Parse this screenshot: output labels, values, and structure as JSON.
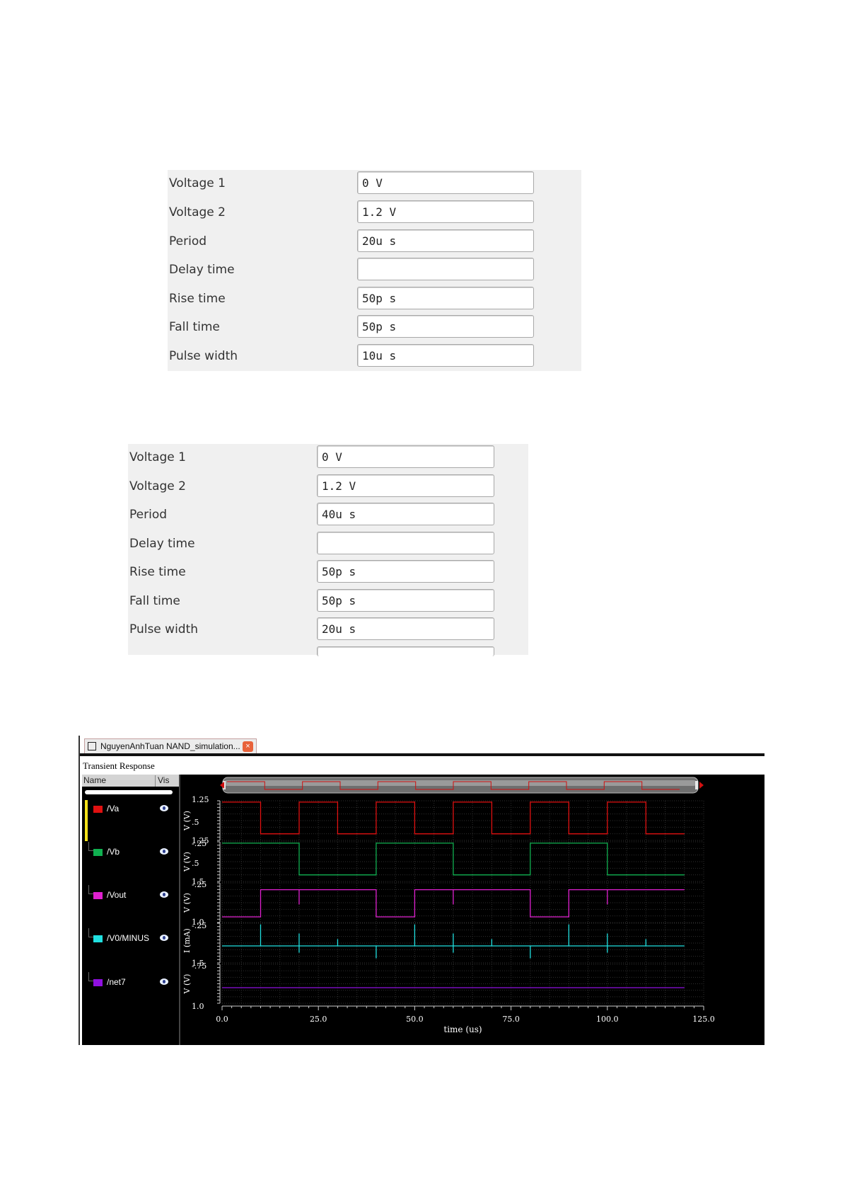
{
  "panel1": {
    "fields": [
      {
        "label": "Voltage 1",
        "value": "0 V"
      },
      {
        "label": "Voltage 2",
        "value": "1.2 V"
      },
      {
        "label": "Period",
        "value": "20u s"
      },
      {
        "label": "Delay time",
        "value": ""
      },
      {
        "label": "Rise time",
        "value": "50p s"
      },
      {
        "label": "Fall time",
        "value": "50p s"
      },
      {
        "label": "Pulse width",
        "value": "10u s"
      }
    ]
  },
  "panel2": {
    "fields": [
      {
        "label": "Voltage 1",
        "value": "0 V"
      },
      {
        "label": "Voltage 2",
        "value": "1.2 V"
      },
      {
        "label": "Period",
        "value": "40u s"
      },
      {
        "label": "Delay time",
        "value": ""
      },
      {
        "label": "Rise time",
        "value": "50p s"
      },
      {
        "label": "Fall time",
        "value": "50p s"
      },
      {
        "label": "Pulse width",
        "value": "20u s"
      }
    ]
  },
  "waveform_window": {
    "tab_title": "NguyenAnhTuan NAND_simulation...",
    "close_glyph": "×",
    "window_title": "Transient Response",
    "signal_list": {
      "name_header": "Name",
      "vis_header": "Vis",
      "signals": [
        {
          "name": "/Va",
          "color": "#e01010"
        },
        {
          "name": "/Vb",
          "color": "#10b050"
        },
        {
          "name": "/Vout",
          "color": "#e020d0"
        },
        {
          "name": "/V0/MINUS",
          "color": "#20e0e0"
        },
        {
          "name": "/net7",
          "color": "#9010e0"
        }
      ]
    }
  },
  "chart_data": {
    "type": "line",
    "xlabel": "time (us)",
    "xlim": [
      0,
      125
    ],
    "x_ticks": [
      "0.0",
      "25.0",
      "50.0",
      "75.0",
      "100.0",
      "125.0"
    ],
    "grid": true,
    "strips": [
      {
        "name": "/Va",
        "ylabel": "V (V)",
        "y_ticks": [
          "1.25",
          ".5",
          "-.25"
        ],
        "ylim": [
          -0.25,
          1.25
        ],
        "color": "#e01010",
        "x": [
          0,
          10,
          10,
          20,
          20,
          30,
          30,
          40,
          40,
          50,
          50,
          60,
          60,
          70,
          70,
          80,
          80,
          90,
          90,
          100,
          100,
          110,
          110,
          120
        ],
        "values": [
          1.2,
          1.2,
          0,
          0,
          1.2,
          1.2,
          0,
          0,
          1.2,
          1.2,
          0,
          0,
          1.2,
          1.2,
          0,
          0,
          1.2,
          1.2,
          0,
          0,
          1.2,
          1.2,
          0,
          0
        ]
      },
      {
        "name": "/Vb",
        "ylabel": "V (V)",
        "y_ticks": [
          "1.25",
          ".5",
          "-.25"
        ],
        "ylim": [
          -0.25,
          1.25
        ],
        "color": "#10b050",
        "x": [
          0,
          20,
          20,
          40,
          40,
          60,
          60,
          80,
          80,
          100,
          100,
          120
        ],
        "values": [
          1.2,
          1.2,
          0,
          0,
          1.2,
          1.2,
          0,
          0,
          1.2,
          1.2,
          0,
          0
        ]
      },
      {
        "name": "/Vout",
        "ylabel": "V (V)",
        "y_ticks": [
          "1.5",
          "-.25"
        ],
        "ylim": [
          -0.25,
          1.5
        ],
        "color": "#e020d0",
        "x": [
          0,
          10,
          10,
          40,
          40,
          50,
          50,
          80,
          80,
          90,
          90,
          120
        ],
        "values": [
          0,
          0,
          1.2,
          1.2,
          0,
          0,
          1.2,
          1.2,
          0,
          0,
          1.2,
          1.2
        ],
        "spikes_x": [
          20,
          60,
          100
        ]
      },
      {
        "name": "/V0/MINUS",
        "ylabel": "I (mA)",
        "y_ticks": [
          "1.0",
          "-.75"
        ],
        "ylim": [
          -0.75,
          1.0
        ],
        "color": "#20e0e0",
        "baseline": 0.0,
        "up_spikes_x": [
          10,
          20,
          30,
          50,
          60,
          70,
          90,
          100,
          110
        ],
        "down_spikes_x": [
          20,
          40,
          60,
          80,
          100
        ]
      },
      {
        "name": "/net7",
        "ylabel": "V (V)",
        "y_ticks": [
          "1.5",
          "1.0"
        ],
        "ylim": [
          1.0,
          1.5
        ],
        "color": "#9010e0",
        "x": [
          0,
          120
        ],
        "values": [
          1.2,
          1.2
        ]
      }
    ]
  }
}
